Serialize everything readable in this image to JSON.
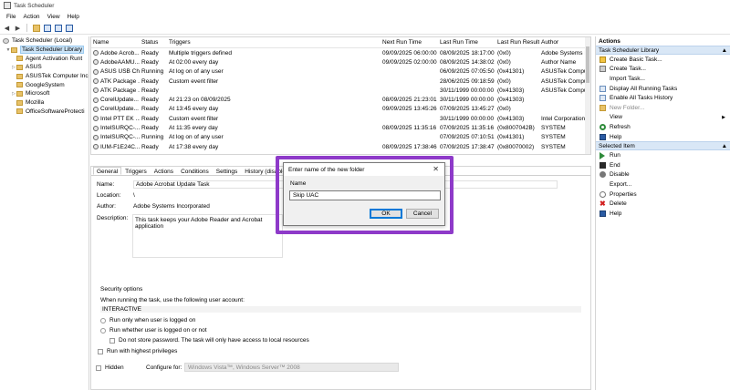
{
  "window": {
    "title": "Task Scheduler"
  },
  "menu": [
    "File",
    "Action",
    "View",
    "Help"
  ],
  "tree": {
    "root": "Task Scheduler (Local)",
    "library": "Task Scheduler Library",
    "folders": [
      "Agent Activation Runt",
      "ASUS",
      "ASUSTek Computer Inc",
      "GoogleSystem",
      "Microsoft",
      "Mozilla",
      "OfficeSoftwareProtecti"
    ]
  },
  "tasks": {
    "columns": [
      "Name",
      "Status",
      "Triggers",
      "Next Run Time",
      "Last Run Time",
      "Last Run Result",
      "Author"
    ],
    "rows": [
      [
        "Adobe Acrob...",
        "Ready",
        "Multiple triggers defined",
        "09/09/2025 06:00:00",
        "08/09/2025 18:17:00",
        "(0x0)",
        "Adobe Systems In"
      ],
      [
        "AdobeAAMU...",
        "Ready",
        "At 02:00 every day",
        "09/09/2025 02:00:00",
        "08/09/2025 14:38:02",
        "(0x0)",
        "Author Name"
      ],
      [
        "ASUS USB Ch...",
        "Running",
        "At log on of any user",
        "",
        "06/09/2025 07:05:50",
        "(0x41301)",
        "ASUSTek Compu"
      ],
      [
        "ATK Package ...",
        "Ready",
        "Custom event filter",
        "",
        "28/06/2025 09:18:59",
        "(0x0)",
        "ASUSTek Compu"
      ],
      [
        "ATK Package ...",
        "Ready",
        "",
        "",
        "30/11/1999 00:00:00",
        "(0x41303)",
        "ASUSTek Compu"
      ],
      [
        "CorelUpdate...",
        "Ready",
        "At 21:23 on 08/09/2025",
        "08/09/2025 21:23:01",
        "30/11/1999 00:00:00",
        "(0x41303)",
        ""
      ],
      [
        "CorelUpdate...",
        "Ready",
        "At 13:45 every day",
        "09/09/2025 13:45:26",
        "07/09/2025 13:45:27",
        "(0x0)",
        ""
      ],
      [
        "Intel PTT EK ...",
        "Ready",
        "Custom event filter",
        "",
        "30/11/1999 00:00:00",
        "(0x41303)",
        "Intel Corporation"
      ],
      [
        "IntelSURQC-...",
        "Ready",
        "At 11:35 every day",
        "08/09/2025 11:35:16",
        "07/09/2025 11:35:16",
        "(0x8007042B)",
        "SYSTEM"
      ],
      [
        "IntelSURQC-...",
        "Running",
        "At log on of any user",
        "",
        "07/09/2025 07:10:51",
        "(0x41301)",
        "SYSTEM"
      ],
      [
        "IUM-F1E24C...",
        "Ready",
        "At 17:38 every day",
        "08/09/2025 17:38:46",
        "07/09/2025 17:38:47",
        "(0x80070002)",
        "SYSTEM"
      ],
      [
        "",
        "",
        "",
        "",
        "",
        "",
        ""
      ]
    ]
  },
  "details": {
    "tabs": [
      "General",
      "Triggers",
      "Actions",
      "Conditions",
      "Settings",
      "History (disabled)"
    ],
    "name_label": "Name:",
    "name_value": "Adobe Acrobat Update Task",
    "location_label": "Location:",
    "location_value": "\\",
    "author_label": "Author:",
    "author_value": "Adobe Systems Incorporated",
    "description_label": "Description:",
    "description_value": "This task keeps your Adobe Reader and Acrobat application",
    "security_title": "Security options",
    "security_prompt": "When running the task, use the following user account:",
    "security_account": "INTERACTIVE",
    "opt_logged_on": "Run only when user is logged on",
    "opt_whether": "Run whether user is logged on or not",
    "opt_no_password": "Do not store password.  The task will only have access to local resources",
    "opt_highest": "Run with highest privileges",
    "hidden_label": "Hidden",
    "configure_label": "Configure for:",
    "configure_value": "Windows Vista™, Windows Server™ 2008"
  },
  "actions": {
    "title": "Actions",
    "section1": "Task Scheduler Library",
    "items1": [
      "Create Basic Task...",
      "Create Task...",
      "Import Task...",
      "Display All Running Tasks",
      "Enable All Tasks History",
      "New Folder...",
      "View",
      "Refresh",
      "Help"
    ],
    "section2": "Selected Item",
    "items2": [
      "Run",
      "End",
      "Disable",
      "Export...",
      "Properties",
      "Delete",
      "Help"
    ]
  },
  "dialog": {
    "title": "Enter name of the new folder",
    "close": "✕",
    "name_label": "Name",
    "name_value": "Skip UAC",
    "ok": "OK",
    "cancel": "Cancel"
  },
  "colors": {
    "highlight": "#8e3ac9",
    "selection": "#cce4f7",
    "section": "#d9e7f6"
  }
}
